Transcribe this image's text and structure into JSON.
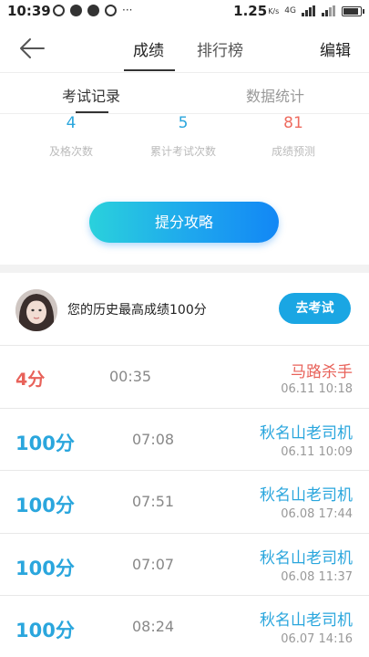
{
  "status_bar": {
    "time": "10:39",
    "speed": "1.25",
    "speed_unit": "K/s",
    "network": "4G",
    "icons": [
      "notification-icon",
      "wechat-icon",
      "message-icon",
      "sync-icon"
    ],
    "more": "···"
  },
  "nav": {
    "tabs": [
      {
        "label": "成绩",
        "active": true
      },
      {
        "label": "排行榜",
        "active": false
      }
    ],
    "edit_label": "编辑"
  },
  "subtabs": [
    {
      "label": "考试记录",
      "active": true
    },
    {
      "label": "数据统计",
      "active": false
    }
  ],
  "stats": [
    {
      "value": "4",
      "label": "及格次数",
      "color": "#2aa6dd"
    },
    {
      "value": "5",
      "label": "累计考试次数",
      "color": "#2aa6dd"
    },
    {
      "value": "81",
      "label": "成绩预测",
      "color": "#ee6b5f"
    }
  ],
  "strategy_button": "提分攻略",
  "best": {
    "text": "您的历史最高成绩100分",
    "button": "去考试"
  },
  "records": [
    {
      "score": "4分",
      "duration": "00:35",
      "title": "马路杀手",
      "date": "06.11  10:18",
      "color": "#e8625a"
    },
    {
      "score": "100分",
      "duration": "07:08",
      "title": "秋名山老司机",
      "date": "06.11  10:09",
      "color": "#2aa6dd"
    },
    {
      "score": "100分",
      "duration": "07:51",
      "title": "秋名山老司机",
      "date": "06.08  17:44",
      "color": "#2aa6dd"
    },
    {
      "score": "100分",
      "duration": "07:07",
      "title": "秋名山老司机",
      "date": "06.08  11:37",
      "color": "#2aa6dd"
    },
    {
      "score": "100分",
      "duration": "08:24",
      "title": "秋名山老司机",
      "date": "06.07  14:16",
      "color": "#2aa6dd"
    }
  ],
  "colors": {
    "accent": "#2aa6dd",
    "fail": "#e8625a",
    "button": "#1aa6e3"
  }
}
